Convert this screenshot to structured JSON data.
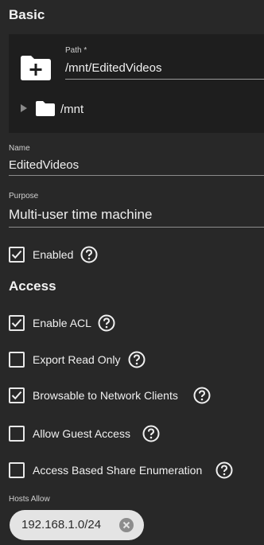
{
  "basic": {
    "title": "Basic",
    "path_label": "Path *",
    "path_value": "/mnt/EditedVideos",
    "tree_root": "/mnt"
  },
  "name_field": {
    "label": "Name",
    "value": "EditedVideos"
  },
  "purpose_field": {
    "label": "Purpose",
    "value": "Multi-user time machine"
  },
  "enabled": {
    "label": "Enabled",
    "checked": true
  },
  "access": {
    "title": "Access",
    "options": [
      {
        "label": "Enable ACL",
        "checked": true
      },
      {
        "label": "Export Read Only",
        "checked": false
      },
      {
        "label": "Browsable to Network Clients",
        "checked": true
      },
      {
        "label": "Allow Guest Access",
        "checked": false
      },
      {
        "label": "Access Based Share Enumeration",
        "checked": false
      }
    ]
  },
  "hosts_allow": {
    "label": "Hosts Allow",
    "chips": [
      "192.168.1.0/24"
    ]
  },
  "colors": {
    "background": "#282828",
    "panel": "#1e1e1e",
    "text": "#f0f0f0",
    "chip": "#e4e4e4"
  }
}
